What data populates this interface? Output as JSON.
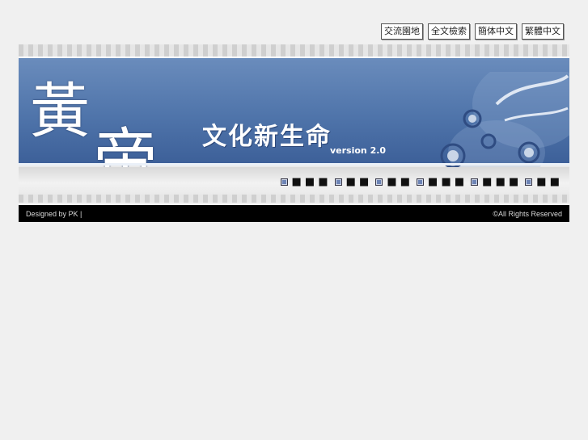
{
  "topbar": {
    "buttons": [
      {
        "label": "交流園地"
      },
      {
        "label": "全文檢索"
      },
      {
        "label": "簡体中文"
      },
      {
        "label": "繁體中文"
      }
    ]
  },
  "banner": {
    "brush_char_1": "黃",
    "brush_char_2": "帝",
    "site_title": "文化新生命",
    "version": "version 2.0"
  },
  "nav": {
    "items": [
      {
        "label": "■ ■ ■"
      },
      {
        "label": "■ ■"
      },
      {
        "label": "■ ■"
      },
      {
        "label": "■ ■ ■"
      },
      {
        "label": "■ ■ ■"
      },
      {
        "label": "■ ■"
      }
    ]
  },
  "footer": {
    "left": "Designed by PK |",
    "right": "©All Rights Reserved"
  },
  "colors": {
    "background": "#f0f0f0",
    "banner_blue": "#4f74aa",
    "footer_bg": "#000000"
  }
}
